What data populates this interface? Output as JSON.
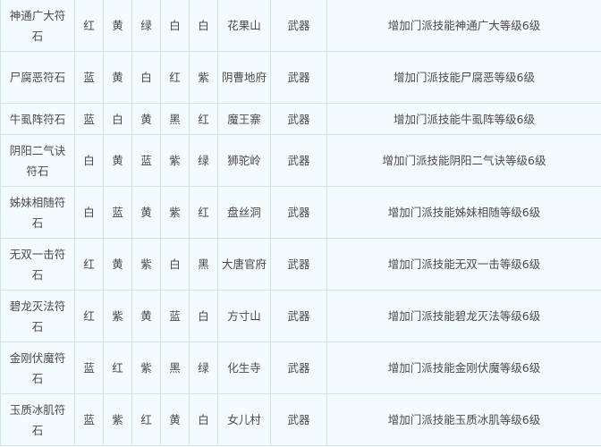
{
  "rows": [
    {
      "name": "神通广大符石",
      "c1": "红",
      "c2": "黄",
      "c3": "绿",
      "c4": "白",
      "c5": "白",
      "sect": "花果山",
      "slot": "武器",
      "effect": "增加门派技能神通广大等级6级",
      "size": "h58"
    },
    {
      "name": "尸腐恶符石",
      "c1": "蓝",
      "c2": "黄",
      "c3": "白",
      "c4": "红",
      "c5": "紫",
      "sect": "阴曹地府",
      "slot": "武器",
      "effect": "增加门派技能尸腐恶等级6级",
      "size": "h58"
    },
    {
      "name": "牛虱阵符石",
      "c1": "蓝",
      "c2": "白",
      "c3": "黄",
      "c4": "黑",
      "c5": "红",
      "sect": "魔王寨",
      "slot": "武器",
      "effect": "增加门派技能牛虱阵等级6级",
      "size": "h35"
    },
    {
      "name": "阴阳二气诀符石",
      "c1": "白",
      "c2": "黄",
      "c3": "蓝",
      "c4": "紫",
      "c5": "绿",
      "sect": "狮驼岭",
      "slot": "武器",
      "effect": "增加门派技能阴阳二气诀等级6级",
      "size": "h58"
    },
    {
      "name": "姊妹相随符石",
      "c1": "白",
      "c2": "蓝",
      "c3": "黄",
      "c4": "紫",
      "c5": "红",
      "sect": "盘丝洞",
      "slot": "武器",
      "effect": "增加门派技能姊妹相随等级6级",
      "size": "h58"
    },
    {
      "name": "无双一击符石",
      "c1": "红",
      "c2": "黄",
      "c3": "紫",
      "c4": "白",
      "c5": "黑",
      "sect": "大唐官府",
      "slot": "武器",
      "effect": "增加门派技能无双一击等级6级",
      "size": "h58"
    },
    {
      "name": "碧龙灭法符石",
      "c1": "红",
      "c2": "紫",
      "c3": "黄",
      "c4": "蓝",
      "c5": "白",
      "sect": "方寸山",
      "slot": "武器",
      "effect": "增加门派技能碧龙灭法等级6级",
      "size": "h58"
    },
    {
      "name": "金刚伏魔符石",
      "c1": "蓝",
      "c2": "红",
      "c3": "紫",
      "c4": "黑",
      "c5": "绿",
      "sect": "化生寺",
      "slot": "武器",
      "effect": "增加门派技能金刚伏魔等级6级",
      "size": "h58"
    },
    {
      "name": "玉质冰肌符石",
      "c1": "蓝",
      "c2": "紫",
      "c3": "红",
      "c4": "黄",
      "c5": "白",
      "sect": "女儿村",
      "slot": "武器",
      "effect": "增加门派技能玉质冰肌等级6级",
      "size": "h58"
    }
  ]
}
